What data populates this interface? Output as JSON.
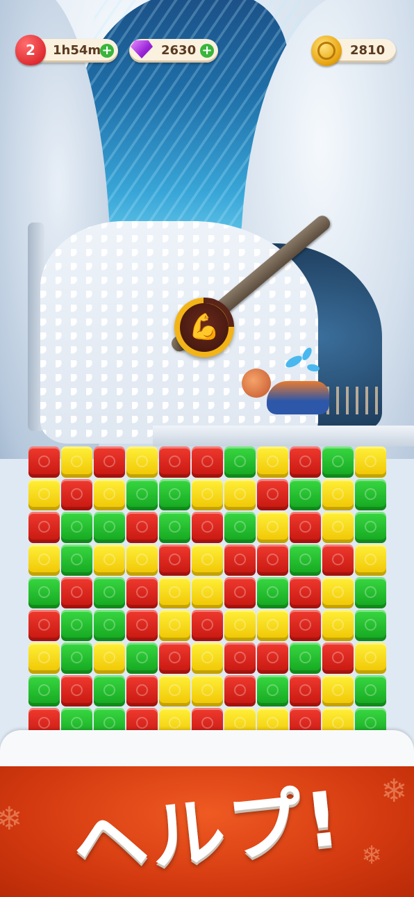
{
  "hud": {
    "lives_count": "2",
    "lives_timer": "1h54m",
    "gems": "2630",
    "coins": "2810",
    "plus": "+"
  },
  "powerup": {
    "icon": "flexed-arm-icon",
    "glyph": "💪"
  },
  "board": {
    "cols": 11,
    "rows": [
      [
        "red",
        "yellow",
        "red",
        "yellow",
        "red",
        "red",
        "green",
        "yellow",
        "red",
        "green",
        "yellow"
      ],
      [
        "yellow",
        "red",
        "yellow",
        "green",
        "green",
        "yellow",
        "yellow",
        "red",
        "green",
        "yellow",
        "green"
      ],
      [
        "red",
        "green",
        "green",
        "red",
        "green",
        "red",
        "green",
        "yellow",
        "red",
        "yellow",
        "green"
      ],
      [
        "yellow",
        "green",
        "yellow",
        "yellow",
        "red",
        "yellow",
        "red",
        "red",
        "green",
        "red",
        "yellow"
      ],
      [
        "green",
        "red",
        "green",
        "red",
        "yellow",
        "yellow",
        "red",
        "green",
        "red",
        "yellow",
        "green"
      ],
      [
        "red",
        "green",
        "green",
        "red",
        "yellow",
        "red",
        "yellow",
        "yellow",
        "red",
        "yellow",
        "green"
      ],
      [
        "yellow",
        "green",
        "yellow",
        "green",
        "red",
        "yellow",
        "red",
        "red",
        "green",
        "red",
        "yellow"
      ],
      [
        "green",
        "red",
        "green",
        "red",
        "yellow",
        "yellow",
        "red",
        "green",
        "red",
        "yellow",
        "green"
      ],
      [
        "red",
        "green",
        "green",
        "red",
        "yellow",
        "red",
        "yellow",
        "yellow",
        "red",
        "yellow",
        "green"
      ]
    ],
    "colors": {
      "red": "#e02a20",
      "yellow": "#f7da10",
      "green": "#22c22e"
    }
  },
  "banner": {
    "text": "ヘルプ!"
  }
}
